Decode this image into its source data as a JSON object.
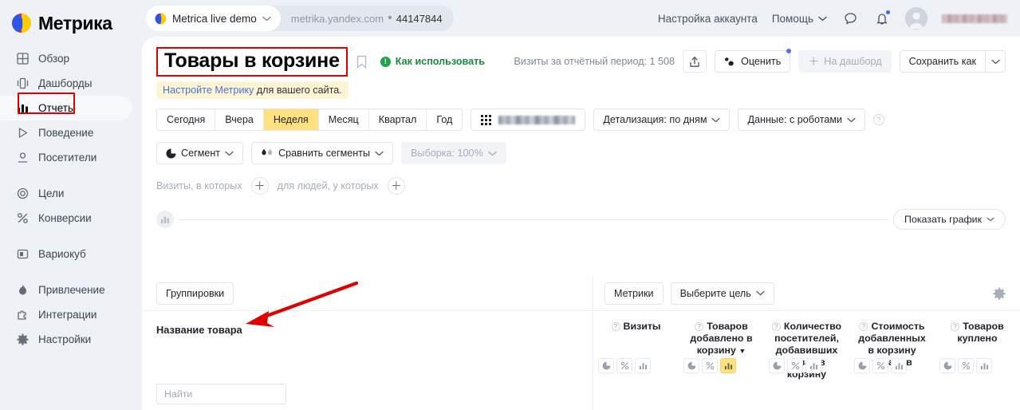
{
  "brand": {
    "name": "Метрика",
    "logo_icon": "metrica-logo-icon"
  },
  "sidebar": {
    "groups": [
      {
        "items": [
          {
            "label": "Обзор",
            "icon": "grid-icon",
            "active": false
          },
          {
            "label": "Дашборды",
            "icon": "dashboard-icon",
            "active": false
          },
          {
            "label": "Отчеты",
            "icon": "bar-chart-icon",
            "active": true
          },
          {
            "label": "Поведение",
            "icon": "play-icon",
            "active": false
          },
          {
            "label": "Посетители",
            "icon": "person-icon",
            "active": false
          }
        ]
      },
      {
        "items": [
          {
            "label": "Цели",
            "icon": "target-icon",
            "active": false
          },
          {
            "label": "Конверсии",
            "icon": "percent-icon",
            "active": false
          }
        ]
      },
      {
        "items": [
          {
            "label": "Вариокуб",
            "icon": "variocube-icon",
            "active": false
          }
        ]
      },
      {
        "items": [
          {
            "label": "Привлечение",
            "icon": "flame-icon",
            "active": false
          },
          {
            "label": "Интеграции",
            "icon": "puzzle-icon",
            "active": false
          },
          {
            "label": "Настройки",
            "icon": "gear-icon",
            "active": false
          }
        ]
      }
    ]
  },
  "topbar": {
    "site_name": "Metrica live demo",
    "site_url": "metrika.yandex.com",
    "separator": "•",
    "counter_id": "44147844",
    "account_settings": "Настройка аккаунта",
    "help": "Помощь",
    "chat_icon": "chat-bubble-icon",
    "bell_icon": "bell-icon",
    "avatar_icon": "avatar-icon",
    "user_name": ""
  },
  "header": {
    "title": "Товары в корзине",
    "bookmark_icon": "bookmark-icon",
    "how_to_use": "Как использовать",
    "how_to_use_icon": "info-circle-icon",
    "visits_note": "Визиты за отчётный период: 1 508",
    "share_icon": "share-icon",
    "rate_label": "Оценить",
    "rate_icon": "thumbs-icon",
    "dashboard_label": "На дашборд",
    "dashboard_icon": "plus-icon",
    "save_as_label": "Сохранить как",
    "save_as_caret_icon": "chevron-down-icon"
  },
  "notice": {
    "link": "Настройте Метрику",
    "text": " для вашего сайта."
  },
  "period": {
    "options": [
      "Сегодня",
      "Вчера",
      "Неделя",
      "Месяц",
      "Квартал",
      "Год"
    ],
    "selected": "Неделя",
    "calendar_icon": "calendar-icon",
    "date_range": "",
    "detail": "Детализация: по дням",
    "data": "Данные: с роботами",
    "help_icon": "question-mark-icon"
  },
  "segments": {
    "segment_label": "Сегмент",
    "segment_icon": "pie-slice-icon",
    "compare_label": "Сравнить сегменты",
    "compare_icon": "two-drops-icon",
    "sample_label": "Выборка: 100%"
  },
  "filters": {
    "visits_label": "Визиты, в которых",
    "people_label": "для людей, у которых",
    "add_icon": "plus-icon"
  },
  "chartbar": {
    "chart_icon": "bar-chart-icon",
    "show_chart_label": "Показать график",
    "caret_icon": "chevron-down-icon"
  },
  "table": {
    "groupings_button": "Группировки",
    "left_column_header": "Название товара",
    "search_placeholder": "Найти",
    "metrics_button": "Метрики",
    "select_goal_button": "Выберите цель",
    "select_goal_caret": "chevron-down-icon",
    "settings_icon": "gear-icon",
    "metric_icons": [
      "pie-chart-icon",
      "percent-icon",
      "bar-chart-icon"
    ],
    "columns": [
      {
        "title": "Визиты",
        "sorted": false,
        "active_icon": -1
      },
      {
        "title": "Товаров добавлено в корзину",
        "sorted": true,
        "sort_caret": "▼",
        "active_icon": 2
      },
      {
        "title": "Количество посетителей, добавивших товар в корзину",
        "sorted": false,
        "active_icon": -1
      },
      {
        "title": "Стоимость добавленных в корзину товаров",
        "sorted": false,
        "active_icon": -1
      },
      {
        "title": "Товаров куплено",
        "sorted": false,
        "active_icon": -1
      }
    ]
  },
  "annotations": {
    "arrow_color": "#e00000",
    "highlight_color": "#e00000"
  }
}
